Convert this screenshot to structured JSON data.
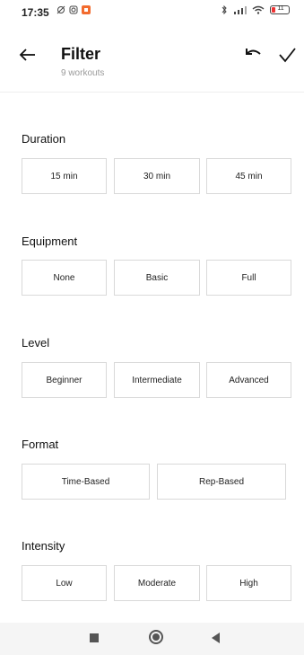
{
  "status": {
    "time": "17:35",
    "battery": "11"
  },
  "header": {
    "title": "Filter",
    "subtitle": "9 workouts"
  },
  "sections": {
    "duration": {
      "title": "Duration",
      "options": [
        "15 min",
        "30 min",
        "45 min"
      ]
    },
    "equipment": {
      "title": "Equipment",
      "options": [
        "None",
        "Basic",
        "Full"
      ]
    },
    "level": {
      "title": "Level",
      "options": [
        "Beginner",
        "Intermediate",
        "Advanced"
      ]
    },
    "format": {
      "title": "Format",
      "options": [
        "Time-Based",
        "Rep-Based"
      ]
    },
    "intensity": {
      "title": "Intensity",
      "options": [
        "Low",
        "Moderate",
        "High"
      ]
    }
  },
  "icons": {
    "back": "back-arrow-icon",
    "undo": "undo-icon",
    "apply": "checkmark-icon",
    "nav_recent": "square-icon",
    "nav_home": "circle-icon",
    "nav_back": "triangle-icon"
  },
  "colors": {
    "text": "#222222",
    "muted": "#9a9a9a",
    "border": "#d9d9d9",
    "statusbar_accent": "#f26b2e"
  }
}
